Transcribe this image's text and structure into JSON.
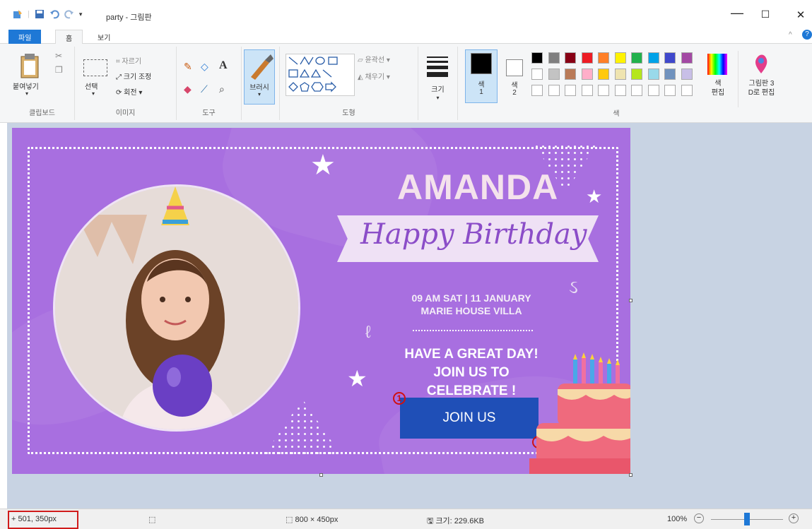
{
  "window": {
    "file_name": "party",
    "app_name": "그림판",
    "title_sep": "-",
    "minimize": "—",
    "maximize": "☐",
    "close": "✕"
  },
  "tabs": {
    "file": "파일",
    "home": "홈",
    "view": "보기"
  },
  "ribbon": {
    "clipboard": {
      "paste": "붙여넣기",
      "label": "클립보드"
    },
    "image": {
      "select": "선택",
      "crop": "자르기",
      "resize": "크기 조정",
      "rotate": "회전 ▾",
      "label": "이미지"
    },
    "tools": {
      "label": "도구"
    },
    "brush": {
      "label": "브러시"
    },
    "shapes": {
      "outline": "윤곽선 ▾",
      "fill": "채우기 ▾",
      "label": "도형"
    },
    "size": {
      "label": "크기"
    },
    "color1": {
      "label": "색",
      "num": "1"
    },
    "color2": {
      "label": "색",
      "num": "2"
    },
    "colors_label": "색",
    "edit_colors": "색\n편집",
    "paint3d": "그림판 3\nD로 편집"
  },
  "palette": [
    "#000000",
    "#7f7f7f",
    "#880015",
    "#ed1c24",
    "#ff7f27",
    "#fff200",
    "#22b14c",
    "#00a2e8",
    "#3f48cc",
    "#a349a4",
    "#ffffff",
    "#c3c3c3",
    "#b97a57",
    "#ffaec9",
    "#ffc90e",
    "#efe4b0",
    "#b5e61d",
    "#99d9ea",
    "#7092be",
    "#c8bfe7"
  ],
  "card": {
    "name": "AMANDA",
    "script": "Happy Birthday",
    "event_line1": "09 AM SAT | 11 JANUARY",
    "event_line2": "MARIE HOUSE VILLA",
    "msg_line1": "HAVE A GREAT DAY!",
    "msg_line2": "JOIN US TO CELEBRATE !",
    "join": "JOIN US",
    "marker1": "1",
    "marker2": "2",
    "bg_color": "#a86fe0",
    "button_color": "#1f4fb7"
  },
  "status": {
    "cursor_pos": "501, 350px",
    "dimensions": "800 × 450px",
    "file_size": "크기: 229.6KB",
    "zoom": "100%"
  }
}
